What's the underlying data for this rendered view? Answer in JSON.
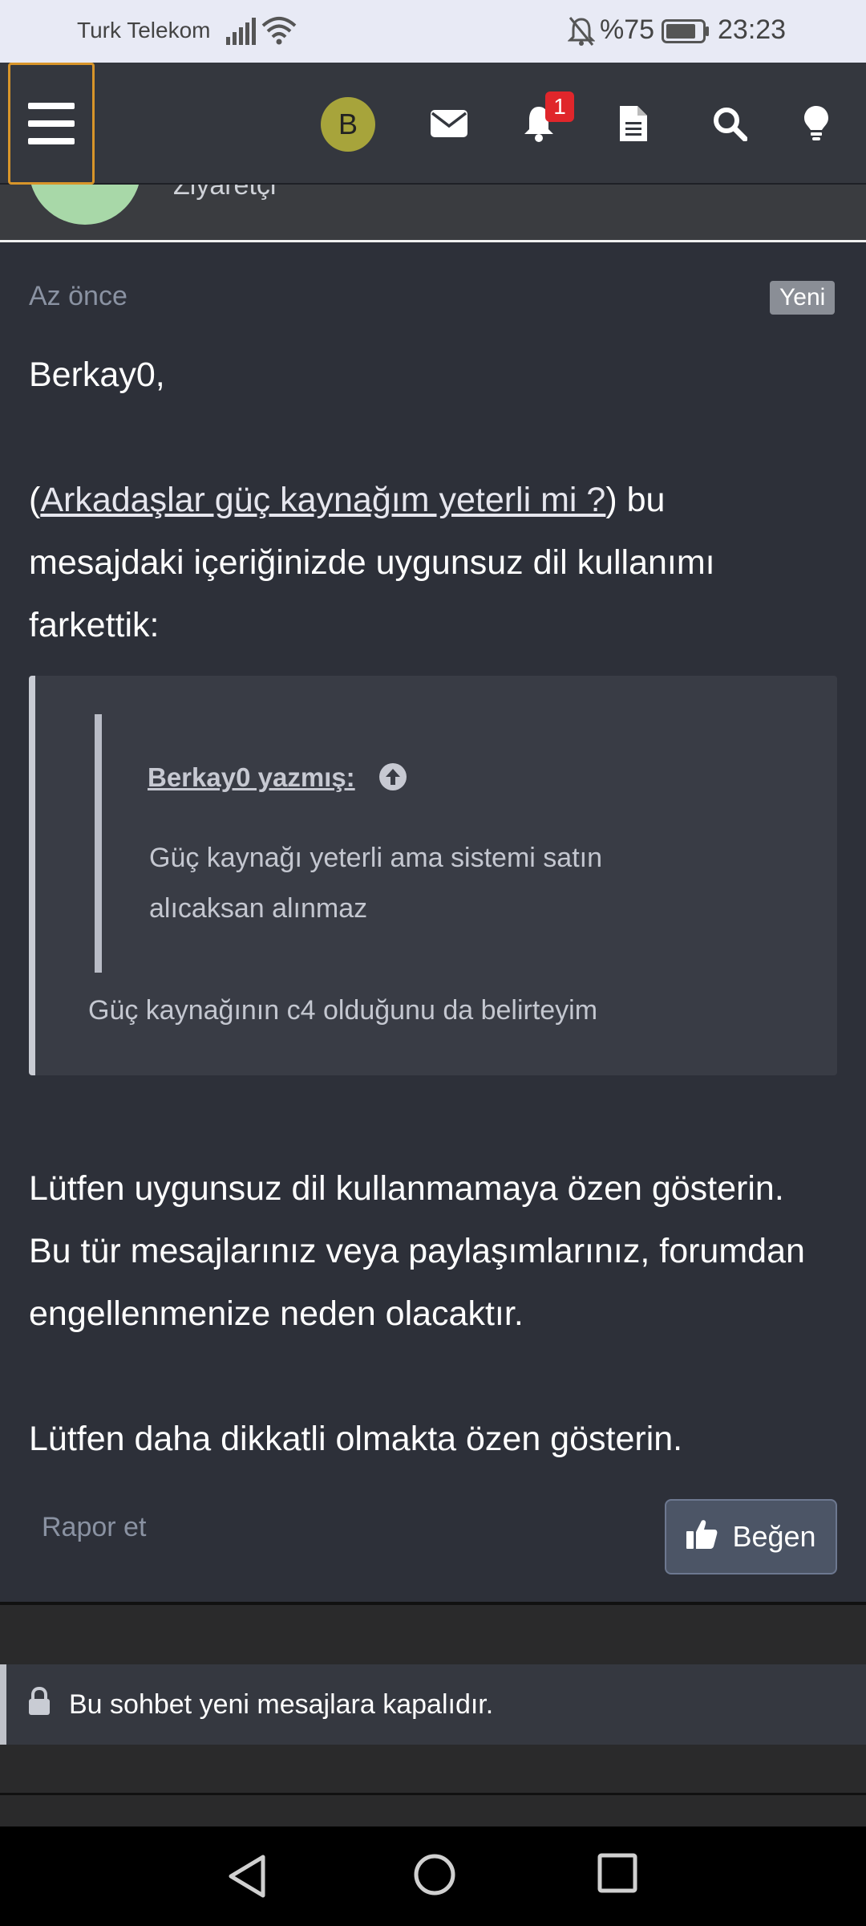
{
  "status_bar": {
    "carrier": "Turk Telekom",
    "battery_text": "%75",
    "time": "23:23"
  },
  "navbar": {
    "avatar_letter": "B",
    "notification_count": "1",
    "icons": [
      "menu-icon",
      "envelope-icon",
      "bell-icon",
      "document-icon",
      "search-icon",
      "lightbulb-icon"
    ],
    "focus_color": "#d8952a"
  },
  "profile": {
    "role_partial": "Ziyaretçi"
  },
  "post": {
    "time": "Az önce",
    "new_badge": "Yeni",
    "greeting": "Berkay0,",
    "para1_open": "(",
    "para1_link": "Arkadaşlar güç kaynağım yeterli mi ?",
    "para1_rest_line1": ") bu",
    "para1_line2": "mesajdaki içeriğinizde uygunsuz dil kullanımı",
    "para1_line3": "farkettik:",
    "quote": {
      "author": "Berkay0 yazmış:",
      "text": "Güç kaynağı yeterli ama sistemi satın alıcaksan alınmaz",
      "after": "Güç kaynağının c4 olduğunu da belirteyim"
    },
    "para2_line1": "Lütfen uygunsuz dil kullanmamaya özen gösterin.",
    "para2_line2": "Bu tür mesajlarınız veya paylaşımlarınız, forumdan",
    "para2_line3": "engellenmenize neden olacaktır.",
    "para3": "Lütfen daha dikkatli olmakta özen gösterin.",
    "report_label": "Rapor et",
    "like_label": "Beğen"
  },
  "thread": {
    "closed_notice": "Bu sohbet yeni mesajlara kapalıdır."
  }
}
